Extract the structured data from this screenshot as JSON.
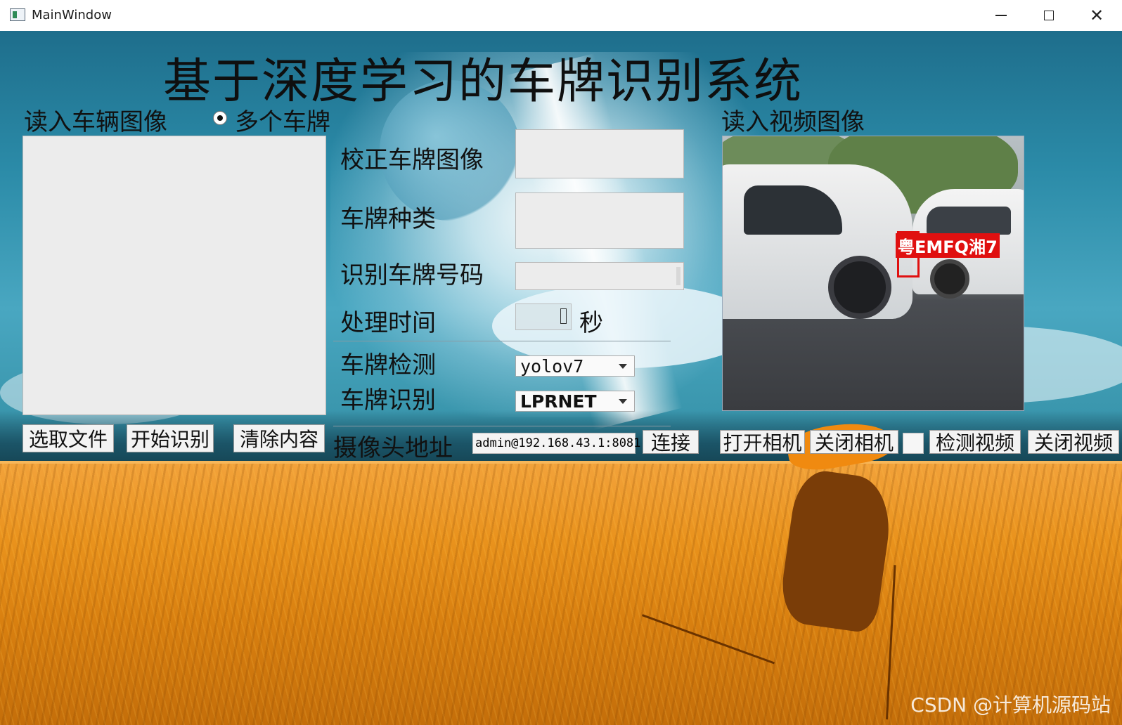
{
  "window": {
    "title": "MainWindow"
  },
  "app": {
    "title": "基于深度学习的车牌识别系统"
  },
  "left": {
    "read_vehicle_label": "读入车辆图像",
    "multi_plate_label": "多个车牌",
    "multi_plate_checked": true
  },
  "middle": {
    "corrected_plate_label": "校正车牌图像",
    "plate_type_label": "车牌种类",
    "plate_number_label": "识别车牌号码",
    "process_time_label": "处理时间",
    "process_time_value": "",
    "seconds_unit": "秒",
    "detect_label": "车牌检测",
    "detect_value": "yolov7",
    "recog_label": "车牌识别",
    "recog_value": "LPRNET",
    "camera_addr_label": "摄像头地址",
    "camera_addr_value": "admin@192.168.43.1:8081"
  },
  "right": {
    "read_video_label": "读入视频图像",
    "plate_overlay_text": "粤EMFQ湘7"
  },
  "buttons": {
    "select_file": "选取文件",
    "start_recog": "开始识别",
    "clear": "清除内容",
    "connect": "连接",
    "open_camera": "打开相机",
    "close_camera": "关闭相机",
    "detect_video": "检测视频",
    "close_video": "关闭视频"
  },
  "watermark": "CSDN @计算机源码站"
}
